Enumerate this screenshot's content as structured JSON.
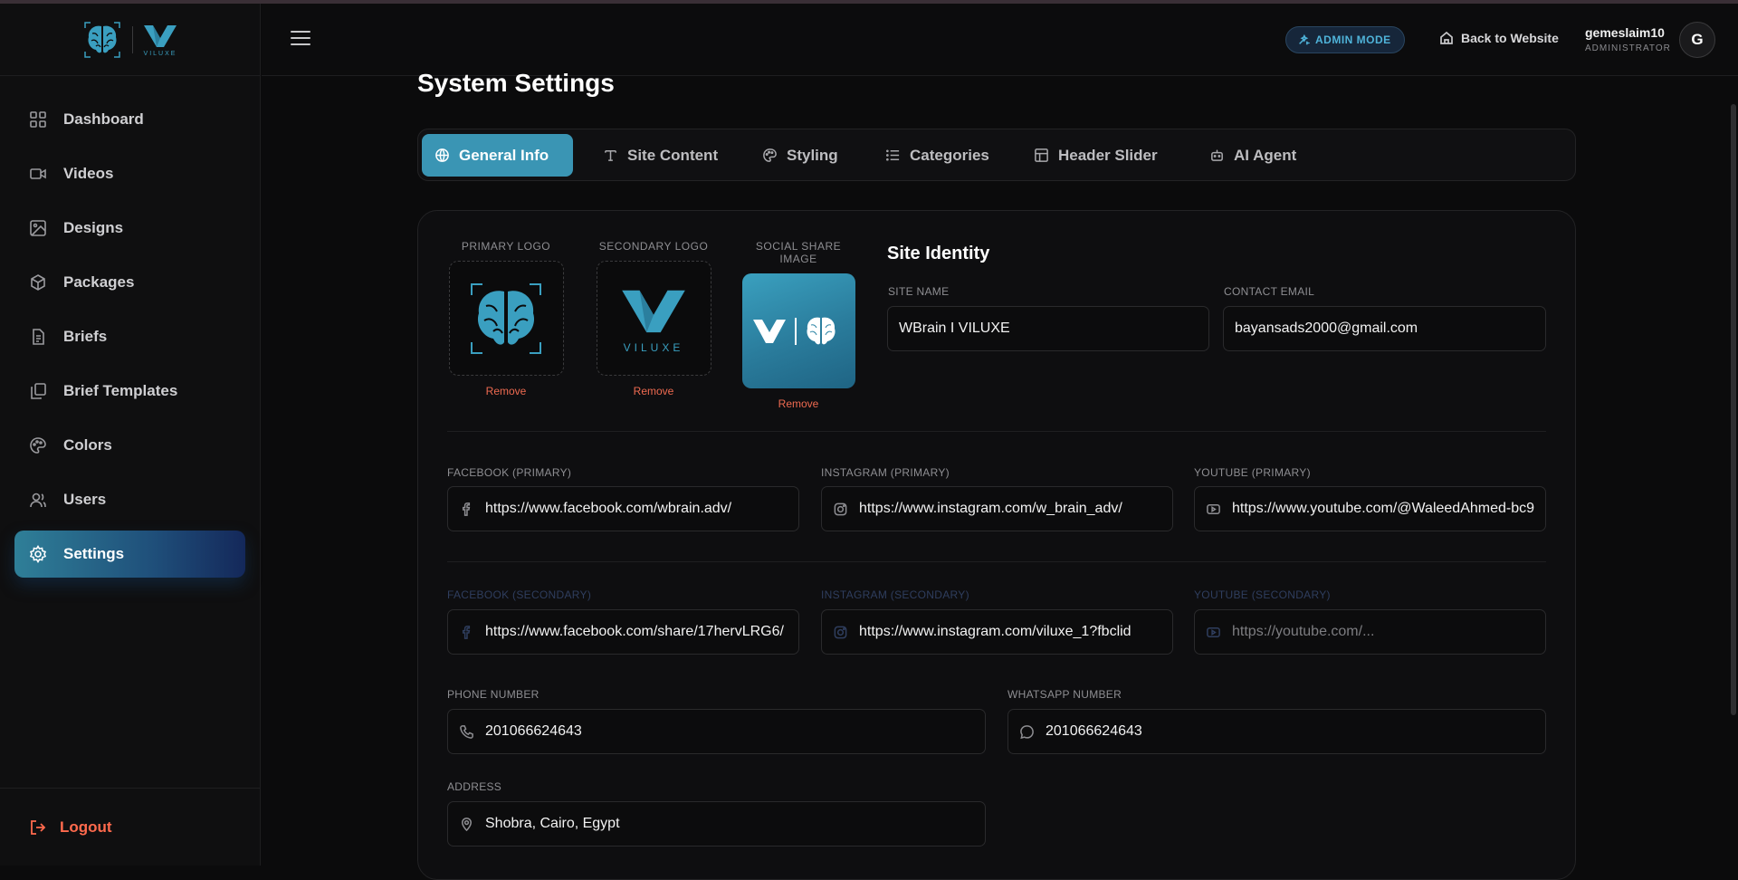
{
  "brand": {
    "name": "VILUXE"
  },
  "sidebar": {
    "items": [
      {
        "label": "Dashboard",
        "icon": "dashboard-icon"
      },
      {
        "label": "Videos",
        "icon": "video-icon"
      },
      {
        "label": "Designs",
        "icon": "image-icon"
      },
      {
        "label": "Packages",
        "icon": "package-icon"
      },
      {
        "label": "Briefs",
        "icon": "document-icon"
      },
      {
        "label": "Brief Templates",
        "icon": "copy-icon"
      },
      {
        "label": "Colors",
        "icon": "palette-icon"
      },
      {
        "label": "Users",
        "icon": "users-icon"
      },
      {
        "label": "Settings",
        "icon": "gear-icon",
        "active": true
      }
    ],
    "logout_label": "Logout"
  },
  "topbar": {
    "admin_badge": "ADMIN MODE",
    "back_label": "Back to Website",
    "user_name": "gemeslaim10",
    "user_role": "ADMINISTRATOR",
    "avatar_initial": "G"
  },
  "page": {
    "title": "System Settings"
  },
  "tabs": [
    {
      "label": "General Info",
      "icon": "globe-icon",
      "active": true
    },
    {
      "label": "Site Content",
      "icon": "text-icon"
    },
    {
      "label": "Styling",
      "icon": "palette-icon"
    },
    {
      "label": "Categories",
      "icon": "list-icon"
    },
    {
      "label": "Header Slider",
      "icon": "layout-icon"
    },
    {
      "label": "AI Agent",
      "icon": "bot-icon"
    }
  ],
  "logos": {
    "primary_label": "PRIMARY LOGO",
    "secondary_label": "SECONDARY LOGO",
    "social_label": "SOCIAL SHARE IMAGE",
    "remove_label": "Remove"
  },
  "identity": {
    "title": "Site Identity",
    "site_name_label": "SITE NAME",
    "site_name_value": "WBrain I VILUXE",
    "contact_email_label": "CONTACT EMAIL",
    "contact_email_value": "bayansads2000@gmail.com"
  },
  "social_primary": {
    "facebook_label": "FACEBOOK (PRIMARY)",
    "facebook_value": "https://www.facebook.com/wbrain.adv/",
    "instagram_label": "INSTAGRAM (PRIMARY)",
    "instagram_value": "https://www.instagram.com/w_brain_adv/",
    "youtube_label": "YOUTUBE (PRIMARY)",
    "youtube_value": "https://www.youtube.com/@WaleedAhmed-bc9"
  },
  "social_secondary": {
    "facebook_label": "FACEBOOK (SECONDARY)",
    "facebook_value": "https://www.facebook.com/share/17hervLRG6/",
    "instagram_label": "INSTAGRAM (SECONDARY)",
    "instagram_value": "https://www.instagram.com/viluxe_1?fbclid",
    "youtube_label": "YOUTUBE (SECONDARY)",
    "youtube_placeholder": "https://youtube.com/..."
  },
  "contact": {
    "phone_label": "PHONE NUMBER",
    "phone_value": "201066624643",
    "whatsapp_label": "WHATSAPP NUMBER",
    "whatsapp_value": "201066624643",
    "address_label": "ADDRESS",
    "address_value": "Shobra, Cairo, Egypt"
  },
  "colors": {
    "accent": "#3a95b4",
    "danger": "#ee6a50",
    "badge_text": "#4fb3d9"
  }
}
